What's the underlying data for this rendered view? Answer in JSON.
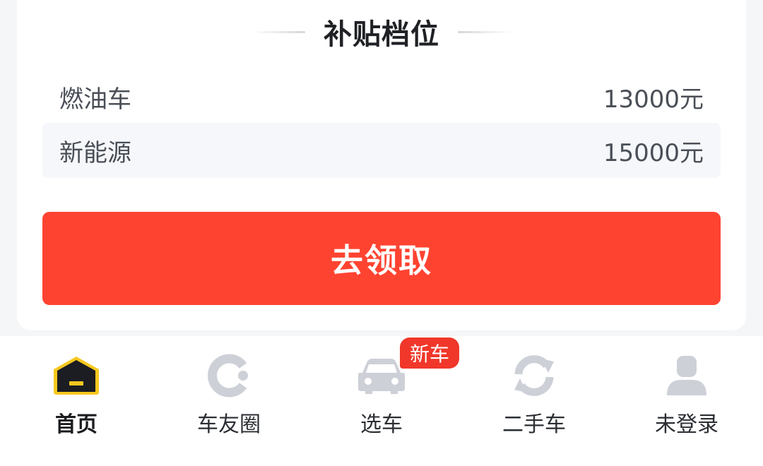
{
  "subsidy": {
    "title": "补贴档位",
    "tiers": [
      {
        "label": "燃油车",
        "value": "13000元"
      },
      {
        "label": "新能源",
        "value": "15000元"
      }
    ],
    "claim_label": "去领取"
  },
  "tabbar": {
    "tabs": [
      {
        "label": "首页",
        "icon": "garage-home-icon",
        "active": true
      },
      {
        "label": "车友圈",
        "icon": "community-circle-icon",
        "active": false
      },
      {
        "label": "选车",
        "icon": "car-icon",
        "active": false,
        "badge": "新车"
      },
      {
        "label": "二手车",
        "icon": "refresh-cycle-icon",
        "active": false
      },
      {
        "label": "未登录",
        "icon": "user-icon",
        "active": false
      }
    ]
  },
  "colors": {
    "accent_red": "#ff4331",
    "badge_red": "#f0372a",
    "home_icon_yellow": "#f6c81e",
    "inactive_icon_gray": "#cdd0d7"
  }
}
